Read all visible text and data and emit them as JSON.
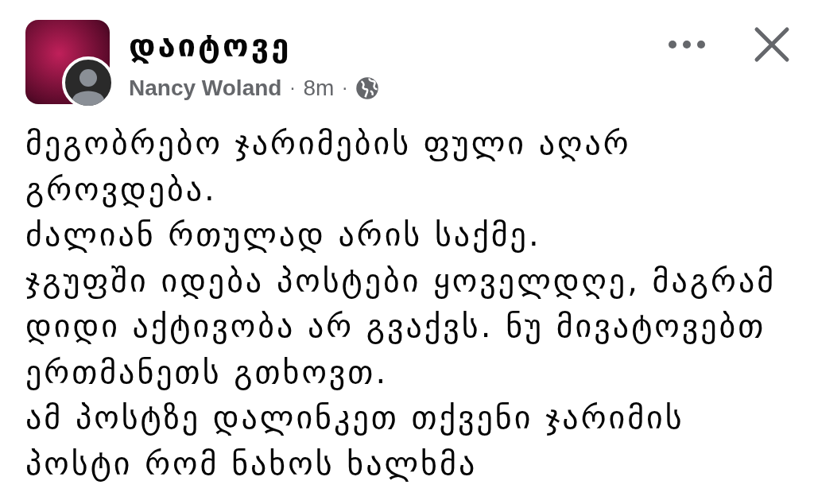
{
  "post": {
    "group_name": "დაიტოვე",
    "author": "Nancy Woland",
    "separator_1": "·",
    "time": "8m",
    "separator_2": "·"
  },
  "body": {
    "lines": [
      "მეგობრებო ჯარიმების ფული აღარ",
      "გროვდება.",
      "ძალიან რთულად არის საქმე.",
      "ჯგუფში იდება პოსტები ყოველდღე, მაგრამ",
      "დიდი აქტივობა არ გვაქვს. ნუ მივატოვებთ",
      "ერთმანეთს გთხოვთ.",
      "ამ პოსტზე დალინკეთ თქვენი ჯარიმის",
      "პოსტი რომ ნახოს ხალხმა"
    ]
  }
}
